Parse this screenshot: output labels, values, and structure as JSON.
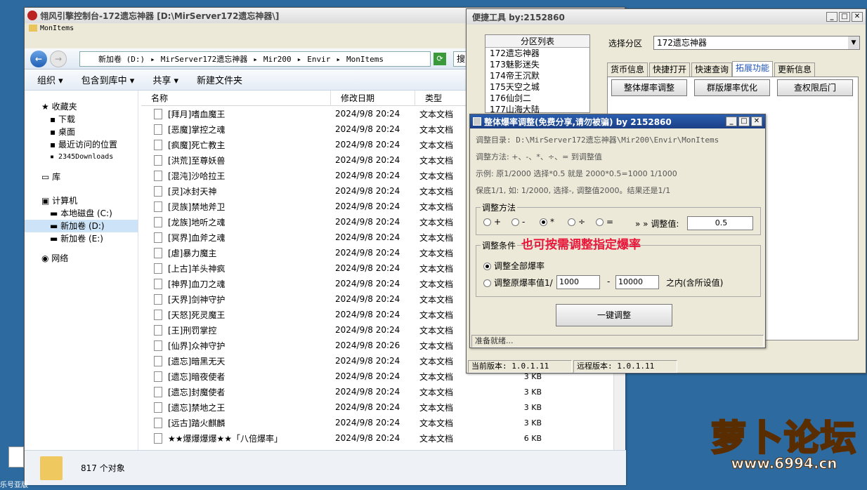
{
  "explorer": {
    "title": "翎风引擎控制台-172遗忘神器 [D:\\MirServer172遗忘神器\\]",
    "folder_title": "MonItems",
    "breadcrumb": [
      "新加卷 (D:)",
      "MirServer172遗忘神器",
      "Mir200",
      "Envir",
      "MonItems"
    ],
    "search_placeholder": "搜",
    "commands": [
      "组织 ▾",
      "包含到库中 ▾",
      "共享 ▾",
      "新建文件夹"
    ],
    "nav": {
      "favorites": "收藏夹",
      "fav_items": [
        "下载",
        "桌面",
        "最近访问的位置",
        "2345Downloads"
      ],
      "library": "库",
      "computer": "计算机",
      "drives": [
        "本地磁盘 (C:)",
        "新加卷 (D:)",
        "新加卷 (E:)"
      ],
      "network": "网络"
    },
    "columns": [
      "名称",
      "修改日期",
      "类型"
    ],
    "files": [
      {
        "n": "[拜月]嗜血魔王",
        "d": "2024/9/8 20:24",
        "t": "文本文档",
        "s": ""
      },
      {
        "n": "[恶魔]掌控之魂",
        "d": "2024/9/8 20:24",
        "t": "文本文档",
        "s": ""
      },
      {
        "n": "[疯魔]死亡教主",
        "d": "2024/9/8 20:24",
        "t": "文本文档",
        "s": ""
      },
      {
        "n": "[洪荒]至尊妖兽",
        "d": "2024/9/8 20:24",
        "t": "文本文档",
        "s": ""
      },
      {
        "n": "[混沌]沙哈拉王",
        "d": "2024/9/8 20:24",
        "t": "文本文档",
        "s": ""
      },
      {
        "n": "[灵]冰封天神",
        "d": "2024/9/8 20:24",
        "t": "文本文档",
        "s": ""
      },
      {
        "n": "[灵族]禁地斧卫",
        "d": "2024/9/8 20:24",
        "t": "文本文档",
        "s": ""
      },
      {
        "n": "[龙族]地听之魂",
        "d": "2024/9/8 20:24",
        "t": "文本文档",
        "s": ""
      },
      {
        "n": "[冥界]血斧之魂",
        "d": "2024/9/8 20:24",
        "t": "文本文档",
        "s": ""
      },
      {
        "n": "[虐]暴力魔主",
        "d": "2024/9/8 20:24",
        "t": "文本文档",
        "s": ""
      },
      {
        "n": "[上古]羊头神疯",
        "d": "2024/9/8 20:24",
        "t": "文本文档",
        "s": ""
      },
      {
        "n": "[神界]血刀之魂",
        "d": "2024/9/8 20:24",
        "t": "文本文档",
        "s": ""
      },
      {
        "n": "[天界]剑神守护",
        "d": "2024/9/8 20:24",
        "t": "文本文档",
        "s": ""
      },
      {
        "n": "[天怒]死灵魔王",
        "d": "2024/9/8 20:24",
        "t": "文本文档",
        "s": ""
      },
      {
        "n": "[王]刑罚掌控",
        "d": "2024/9/8 20:24",
        "t": "文本文档",
        "s": ""
      },
      {
        "n": "[仙界]众神守护",
        "d": "2024/9/8 20:26",
        "t": "文本文档",
        "s": ""
      },
      {
        "n": "[遗忘]暗黑无天",
        "d": "2024/9/8 20:24",
        "t": "文本文档",
        "s": "3 KB"
      },
      {
        "n": "[遗忘]暗夜使者",
        "d": "2024/9/8 20:24",
        "t": "文本文档",
        "s": "3 KB"
      },
      {
        "n": "[遗忘]封魔使者",
        "d": "2024/9/8 20:24",
        "t": "文本文档",
        "s": "3 KB"
      },
      {
        "n": "[遗忘]禁地之王",
        "d": "2024/9/8 20:24",
        "t": "文本文档",
        "s": "3 KB"
      },
      {
        "n": "[远古]踏火麒麟",
        "d": "2024/9/8 20:24",
        "t": "文本文档",
        "s": "3 KB"
      },
      {
        "n": "★★爆爆爆爆★★「八倍爆率」",
        "d": "2024/9/8 20:24",
        "t": "文本文档",
        "s": "6 KB"
      }
    ],
    "status": "817 个对象"
  },
  "tool": {
    "title": "便捷工具 by:2152860",
    "list_title": "分区列表",
    "servers": [
      "172遗忘神器",
      "173魅影迷失",
      "174帝王沉默",
      "175天空之城",
      "176仙剑二",
      "177山海大陆"
    ],
    "select_label": "选择分区",
    "select_value": "172遗忘神器",
    "tabs": [
      "货币信息",
      "快捷打开",
      "快速查询",
      "拓展功能",
      "更新信息"
    ],
    "buttons": [
      "整体爆率调整",
      "群版爆率优化",
      "查权限后门"
    ],
    "cur_version": "当前版本: 1.0.1.11",
    "remote_version": "远程版本: 1.0.1.11"
  },
  "dialog": {
    "title": "整体爆率调整(免费分享,请勿被骗)  by 2152860",
    "dir": "调整目录: D:\\MirServer172遗忘神器\\Mir200\\Envir\\MonItems",
    "method_text": "调整方法: +、-、*、÷、=   到调整值",
    "example": "示例: 原1/2000 选择*0.5 就是 2000*0.5=1000  1/1000",
    "floor": "保底1/1, 如: 1/2000, 选择-, 调整值2000。结果还是1/1",
    "method_group": "调整方法",
    "ops": [
      "+",
      "-",
      "*",
      "÷",
      "="
    ],
    "adj_label": "» » 调整值:",
    "adj_value": "0.5",
    "cond_group": "调整条件",
    "hint": "也可按需调整指定爆率",
    "opt_all": "调整全部爆率",
    "opt_range": "调整原爆率值1/",
    "range_from": "1000",
    "dash": "-",
    "range_to": "10000",
    "range_suffix": "之内(含所设值)",
    "go": "一键调整",
    "status": "准备就绪..."
  },
  "watermark": {
    "text": "萝卜论坛",
    "url": "www.6994.cn"
  },
  "desktop_label": "乐号亚版"
}
